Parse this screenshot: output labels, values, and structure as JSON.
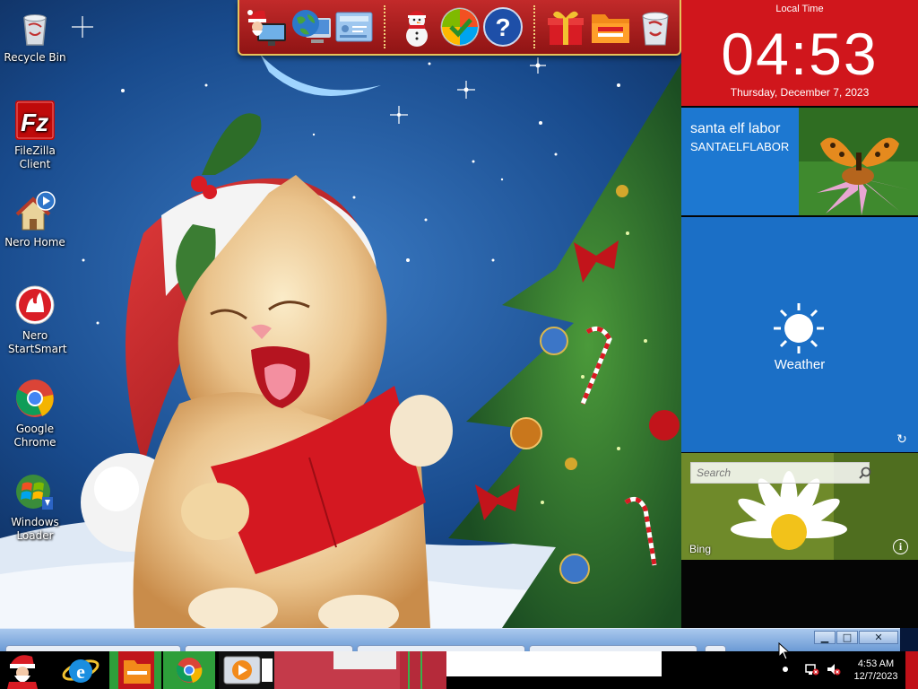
{
  "desktop": {
    "icons": [
      {
        "label": "Recycle Bin",
        "icon": "recycle-bin-icon"
      },
      {
        "label": "FileZilla Client",
        "icon": "filezilla-icon"
      },
      {
        "label": "Nero Home",
        "icon": "nero-home-icon"
      },
      {
        "label": "Nero StartSmart",
        "icon": "nero-startsmart-icon"
      },
      {
        "label": "Google Chrome",
        "icon": "chrome-icon"
      },
      {
        "label": "Windows Loader",
        "icon": "windows-loader-icon"
      }
    ]
  },
  "dock": {
    "items": [
      {
        "icon": "santa-computer-icon"
      },
      {
        "icon": "network-globe-icon"
      },
      {
        "icon": "control-panel-icon"
      },
      {
        "icon": "snowman-icon"
      },
      {
        "icon": "windows-update-icon"
      },
      {
        "icon": "help-icon"
      },
      {
        "icon": "gift-icon"
      },
      {
        "icon": "folder-icon"
      },
      {
        "icon": "trash-icon"
      }
    ]
  },
  "panel": {
    "clock": {
      "caption": "Local Time",
      "time": "04:53",
      "date": "Thursday, December 7, 2023"
    },
    "user": {
      "name": "santa elf labor",
      "id": "SANTAELFLABOR"
    },
    "weather": {
      "label": "Weather",
      "icon": "sun-icon"
    },
    "bing": {
      "search_placeholder": "Search",
      "label": "Bing",
      "info_glyph": "i"
    }
  },
  "window": {
    "controls": {
      "minimize": "▁",
      "maximize": "□",
      "close": "✕"
    }
  },
  "taskbar": {
    "items": [
      {
        "icon": "santa-start-icon"
      },
      {
        "icon": "internet-explorer-icon"
      },
      {
        "icon": "file-explorer-icon"
      },
      {
        "icon": "chrome-icon"
      },
      {
        "icon": "media-player-icon"
      }
    ],
    "tray": {
      "time": "4:53 AM",
      "date": "12/7/2023"
    }
  },
  "colors": {
    "panel_red": "#d0161c",
    "tile_blue": "#1d78d1",
    "weather_blue": "#1b6fc6",
    "dock_red": "#b01e1e"
  }
}
